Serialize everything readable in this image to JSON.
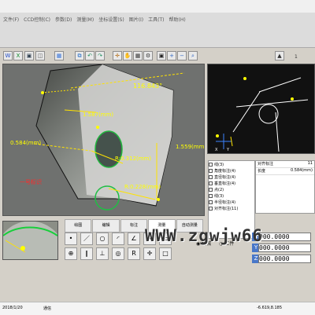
{
  "menu": [
    "文件(F)",
    "CCD控制(C)",
    "参数(D)",
    "测量(M)",
    "坐标设置(S)",
    "图片(I)",
    "工具(T)",
    "帮助(H)"
  ],
  "toolbar": {
    "top_right": "1",
    "top_right_icon": "▲"
  },
  "main": {
    "angle_label": "116.843°",
    "length_label": "1.587(mm)",
    "left_label": "0.584(mm)",
    "radius_label": "R:0.312(mm)",
    "right_label": "1.559(mm)",
    "bottom_radius_label": "R:0.228(mm)",
    "lower_left_label": "一号标识",
    "overlay_text": "WWW.zgwjw66"
  },
  "tabs": [
    "绘图",
    "编辑",
    "标注",
    "测量",
    "自动测量"
  ],
  "options": {
    "mechanical": "机械",
    "workpiece": "工件"
  },
  "table": {
    "header_left": "对齐标注",
    "header_right": "11",
    "row1_label": "长度",
    "row1_value": "0.584(mm)"
  },
  "right_list": [
    "线(3)",
    "角度标注(4)",
    "直径标注(4)",
    "垂直标注(4)",
    "点(2)",
    "线(3)",
    "半径标注(4)",
    "对齐标注(11)"
  ],
  "coords": {
    "x": "000.0000",
    "y": "000.0000",
    "z": "000.0000"
  },
  "status": {
    "left": "2018/1/20",
    "middle": "通信",
    "right": "-6.619,8.185"
  }
}
